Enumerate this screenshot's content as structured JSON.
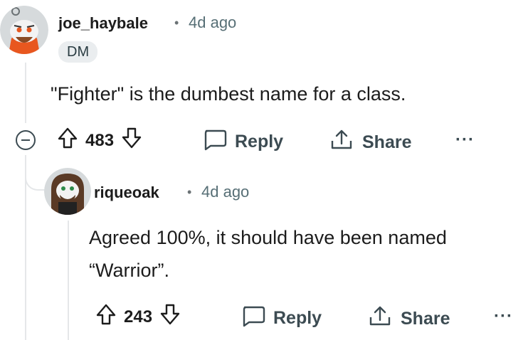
{
  "comments": [
    {
      "username": "joe_haybale",
      "separator": "•",
      "time": "4d ago",
      "flair": "DM",
      "body": "\"Fighter\" is the dumbest name for a class.",
      "votes": "483",
      "reply_label": "Reply",
      "share_label": "Share",
      "more": "···"
    },
    {
      "username": "riqueoak",
      "separator": "•",
      "time": "4d ago",
      "body_line1": "Agreed 100%, it should have been named",
      "body_line2": "“Warrior”.",
      "votes": "243",
      "reply_label": "Reply",
      "share_label": "Share",
      "more": "···"
    }
  ],
  "icons": {
    "upvote": "upvote-arrow-icon",
    "downvote": "downvote-arrow-icon",
    "reply": "speech-bubble-icon",
    "share": "share-upload-icon",
    "collapse": "collapse-minus-icon"
  },
  "colors": {
    "text": "#1c1c1c",
    "muted": "#576f76",
    "action": "#3c4b52",
    "thread": "#e5e7e9",
    "flair_bg": "#eaedef"
  }
}
